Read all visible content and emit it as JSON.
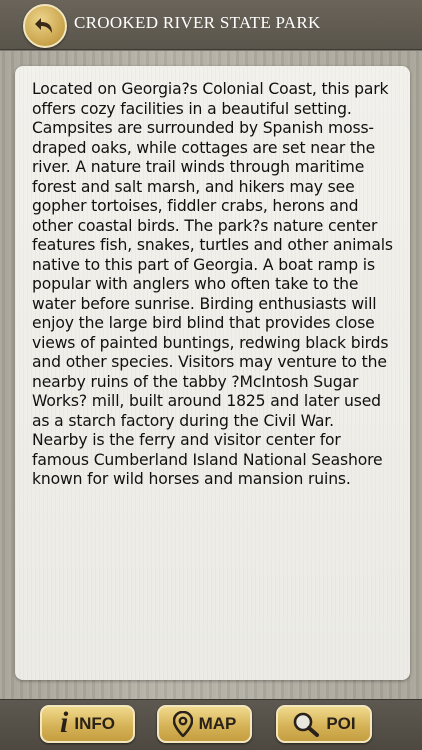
{
  "header": {
    "title": "CROOKED RIVER STATE PARK",
    "back_icon": "back-arrow-icon"
  },
  "content": {
    "description": "Located on Georgia?s Colonial Coast, this park offers cozy facilities in a beautiful setting. Campsites are surrounded by Spanish moss-draped oaks, while cottages are set near the river. A nature trail winds through maritime forest and salt marsh, and hikers may see gopher tortoises, fiddler crabs, herons and other coastal birds. The park?s nature center features fish, snakes, turtles and other animals native to this part of Georgia. A boat ramp is popular with anglers who often take to the water before sunrise. Birding enthusiasts will enjoy the large bird blind that provides close views of painted buntings, redwing black birds and other species. Visitors may venture to the nearby ruins of the tabby ?McIntosh Sugar Works? mill, built around 1825 and later used as a starch factory during the Civil War. Nearby is the ferry and visitor center for famous Cumberland Island National Seashore known for wild horses and mansion ruins."
  },
  "tabs": {
    "info": {
      "label": "INFO",
      "icon": "info-icon"
    },
    "map": {
      "label": "MAP",
      "icon": "map-pin-icon"
    },
    "poi": {
      "label": "POI",
      "icon": "search-icon"
    }
  },
  "colors": {
    "header_bg": "#5f5a51",
    "button_gold": "#d6b358",
    "card_bg": "#f1efea"
  }
}
